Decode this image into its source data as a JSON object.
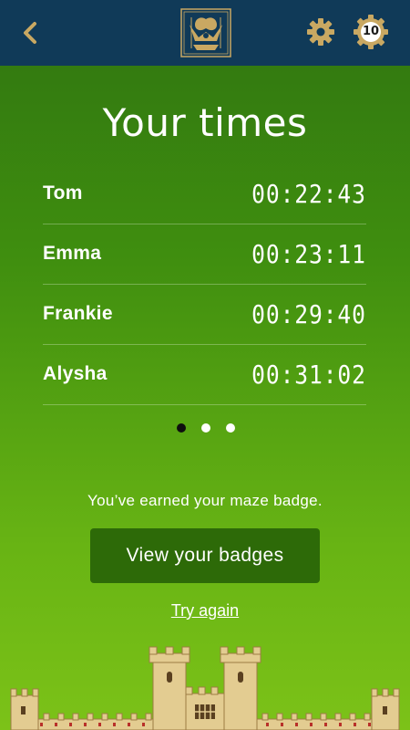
{
  "header": {
    "back_icon": "chevron-left-icon",
    "crest_icon": "heraldic-crest-logo",
    "settings_icon": "gear-icon",
    "level_badge": {
      "icon": "cog-badge-icon",
      "value": "10"
    },
    "colors": {
      "bar": "#103a58",
      "icon": "#c9a862"
    }
  },
  "main": {
    "title": "Your times",
    "times": [
      {
        "name": "Tom",
        "time": "00:22:43"
      },
      {
        "name": "Emma",
        "time": "00:23:11"
      },
      {
        "name": "Frankie",
        "time": "00:29:40"
      },
      {
        "name": "Alysha",
        "time": "00:31:02"
      }
    ],
    "pagination": {
      "pages": 3,
      "active": 1
    },
    "message": "You’ve earned your maze badge.",
    "badges_button": "View your badges",
    "try_again": "Try again",
    "colors": {
      "gradient_top": "#2f7410",
      "gradient_bottom": "#7cc218",
      "button": "#2d6a08"
    }
  },
  "footer": {
    "illustration": "castle-icon"
  }
}
